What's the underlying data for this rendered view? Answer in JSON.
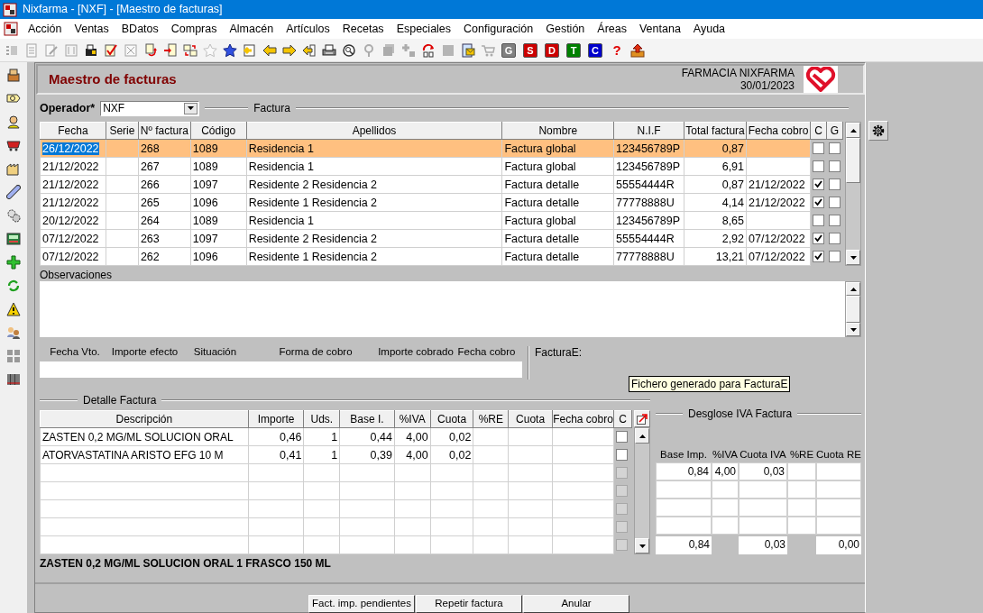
{
  "window": {
    "title": "Nixfarma - [NXF] - [Maestro de facturas]"
  },
  "menu": [
    "Acción",
    "Ventas",
    "BDatos",
    "Compras",
    "Almacén",
    "Artículos",
    "Recetas",
    "Especiales",
    "Configuración",
    "Gestión",
    "Áreas",
    "Ventana",
    "Ayuda"
  ],
  "toolbar": [
    {
      "kind": "icon",
      "disabled": true
    },
    {
      "kind": "icon",
      "disabled": true
    },
    {
      "kind": "icon",
      "disabled": true
    },
    {
      "kind": "icon",
      "disabled": true
    },
    {
      "kind": "icon",
      "disabled": false
    },
    {
      "kind": "icon",
      "disabled": false
    },
    {
      "kind": "icon",
      "disabled": true
    },
    {
      "kind": "icon",
      "disabled": false
    },
    {
      "kind": "icon",
      "disabled": false
    },
    {
      "kind": "icon",
      "disabled": false
    },
    {
      "kind": "icon",
      "disabled": true
    },
    {
      "kind": "icon",
      "disabled": false
    },
    {
      "kind": "icon",
      "disabled": false
    },
    {
      "kind": "icon",
      "disabled": false
    },
    {
      "kind": "icon",
      "disabled": false
    },
    {
      "kind": "icon",
      "disabled": false
    },
    {
      "kind": "icon",
      "disabled": false
    },
    {
      "kind": "icon",
      "disabled": false
    },
    {
      "kind": "icon",
      "disabled": true
    },
    {
      "kind": "icon",
      "disabled": true
    },
    {
      "kind": "icon",
      "disabled": true
    },
    {
      "kind": "icon",
      "disabled": false
    },
    {
      "kind": "icon",
      "disabled": true
    },
    {
      "kind": "icon",
      "disabled": false
    },
    {
      "kind": "icon",
      "disabled": true
    },
    {
      "kind": "letter",
      "label": "G",
      "color": "#808080"
    },
    {
      "kind": "letter",
      "label": "S",
      "color": "#cc0000"
    },
    {
      "kind": "letter",
      "label": "D",
      "color": "#cc0000"
    },
    {
      "kind": "letter",
      "label": "T",
      "color": "#008000"
    },
    {
      "kind": "letter",
      "label": "C",
      "color": "#0000cc"
    },
    {
      "kind": "glyph",
      "label": "?",
      "color": "#e00000"
    },
    {
      "kind": "icon",
      "disabled": false
    }
  ],
  "form": {
    "title": "Maestro de facturas",
    "company": "FARMACIA NIXFARMA",
    "date": "30/01/2023"
  },
  "operator": {
    "label": "Operador*",
    "value": "NXF"
  },
  "invoices": {
    "group": "Factura",
    "columns": [
      "Fecha",
      "Serie",
      "Nº factura",
      "Código",
      "Apellidos",
      "Nombre",
      "N.I.F",
      "Total factura",
      "Fecha cobro",
      "C",
      "G"
    ],
    "rows": [
      {
        "fecha": "26/12/2022",
        "numero": "268",
        "codigo": "1089",
        "apellidos": "Residencia 1",
        "nombre": "Factura global",
        "nif": "123456789P",
        "total": "0,87",
        "c": false,
        "g": false,
        "selected": true
      },
      {
        "fecha": "21/12/2022",
        "numero": "267",
        "codigo": "1089",
        "apellidos": "Residencia 1",
        "nombre": "Factura global",
        "nif": "123456789P",
        "total": "6,91",
        "c": false,
        "g": false,
        "selected": false
      },
      {
        "fecha": "21/12/2022",
        "numero": "266",
        "codigo": "1097",
        "apellidos": "Residente 2 Residencia 2",
        "nombre": "Factura detalle",
        "nif": "55554444R",
        "total": "0,87",
        "fecha_cobro": "21/12/2022",
        "c": true,
        "g": false,
        "selected": false
      },
      {
        "fecha": "21/12/2022",
        "numero": "265",
        "codigo": "1096",
        "apellidos": "Residente 1 Residencia 2",
        "nombre": "Factura detalle",
        "nif": "77778888U",
        "total": "4,14",
        "fecha_cobro": "21/12/2022",
        "c": true,
        "g": false,
        "selected": false
      },
      {
        "fecha": "20/12/2022",
        "numero": "264",
        "codigo": "1089",
        "apellidos": "Residencia 1",
        "nombre": "Factura global",
        "nif": "123456789P",
        "total": "8,65",
        "c": false,
        "g": false,
        "selected": false
      },
      {
        "fecha": "07/12/2022",
        "numero": "263",
        "codigo": "1097",
        "apellidos": "Residente 2 Residencia 2",
        "nombre": "Factura detalle",
        "nif": "55554444R",
        "total": "2,92",
        "fecha_cobro": "07/12/2022",
        "c": true,
        "g": false,
        "selected": false
      },
      {
        "fecha": "07/12/2022",
        "numero": "262",
        "codigo": "1096",
        "apellidos": "Residente 1 Residencia 2",
        "nombre": "Factura detalle",
        "nif": "77778888U",
        "total": "13,21",
        "fecha_cobro": "07/12/2022",
        "c": true,
        "g": false,
        "selected": false
      }
    ]
  },
  "observations": {
    "label": "Observaciones"
  },
  "payment": {
    "fields": [
      "Fecha Vto.",
      "Importe efecto",
      "Situación",
      "Forma de cobro",
      "Importe cobrado",
      "Fecha cobro"
    ],
    "facturae_label": "FacturaE:"
  },
  "tooltip": "Fichero generado para FacturaE",
  "detail": {
    "group": "Detalle Factura",
    "columns": [
      "Descripción",
      "Importe",
      "Uds.",
      "Base I.",
      "%IVA",
      "Cuota",
      "%RE",
      "Cuota",
      "Fecha cobro",
      "C"
    ],
    "rows": [
      {
        "cells": [
          "ZASTEN 0,2 MG/ML SOLUCION ORAL",
          "0,46",
          "1",
          "0,44",
          "4,00",
          "0,02"
        ],
        "checked": false,
        "disabled": false
      },
      {
        "cells": [
          "ATORVASTATINA  ARISTO EFG 10 M",
          "0,41",
          "1",
          "0,39",
          "4,00",
          "0,02"
        ],
        "checked": false,
        "disabled": false
      },
      {
        "checked": false,
        "disabled": true
      },
      {
        "checked": false,
        "disabled": true
      },
      {
        "checked": false,
        "disabled": true
      },
      {
        "checked": false,
        "disabled": true
      },
      {
        "checked": false,
        "disabled": true
      }
    ]
  },
  "vat": {
    "group": "Desglose IVA Factura",
    "columns": [
      "Base Imp.",
      "%IVA",
      "Cuota IVA",
      "%RE",
      "Cuota RE"
    ],
    "rows": [
      [
        "0,84",
        "4,00",
        "0,03"
      ]
    ],
    "totals": {
      "base": "0,84",
      "cuota_iva": "0,03",
      "cuota_re": "0,00"
    }
  },
  "status_text": "ZASTEN 0,2 MG/ML SOLUCION ORAL 1 FRASCO 150 ML",
  "buttons": [
    "Fact. imp. pendientes",
    "Repetir factura",
    "Anular"
  ]
}
